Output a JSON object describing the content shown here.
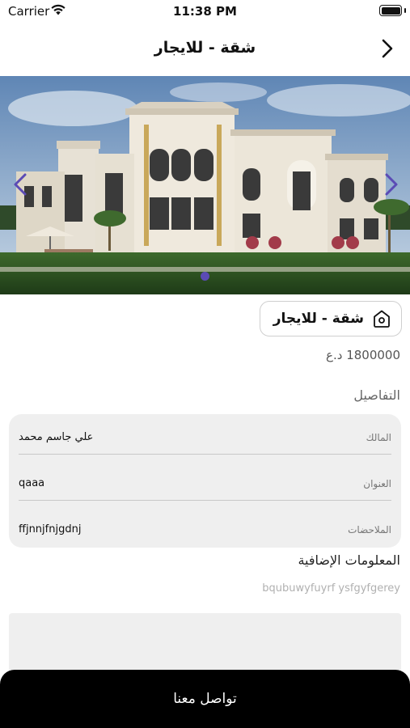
{
  "status_bar": {
    "carrier": "Carrier",
    "time": "11:38 PM",
    "battery_level": 1.0
  },
  "nav": {
    "title": "شقة - للايجار",
    "back_icon": "chevron-right-icon"
  },
  "carousel": {
    "page_count": 1,
    "current_page": 0,
    "prev_icon": "chevron-left-icon",
    "next_icon": "chevron-right-icon",
    "image": "villa-photo"
  },
  "listing": {
    "type_label": "شقة - للايجار",
    "type_icon": "home-icon",
    "price": "1800000 د.ع"
  },
  "details": {
    "title": "التفاصيل",
    "rows": [
      {
        "label": "المالك",
        "value": "علي جاسم محمد"
      },
      {
        "label": "العنوان",
        "value": "qaaa"
      },
      {
        "label": "الملاحضات",
        "value": "ffjnnjfnjgdnj"
      }
    ]
  },
  "extra": {
    "title": "المعلومات الإضافية",
    "text": "bqubuwyfuyrf ysfgyfgerey"
  },
  "contact_button": {
    "label": "تواصل معنا"
  },
  "colors": {
    "accent": "#5b4bb5",
    "card_bg": "#efefef",
    "button_bg": "#000000"
  }
}
